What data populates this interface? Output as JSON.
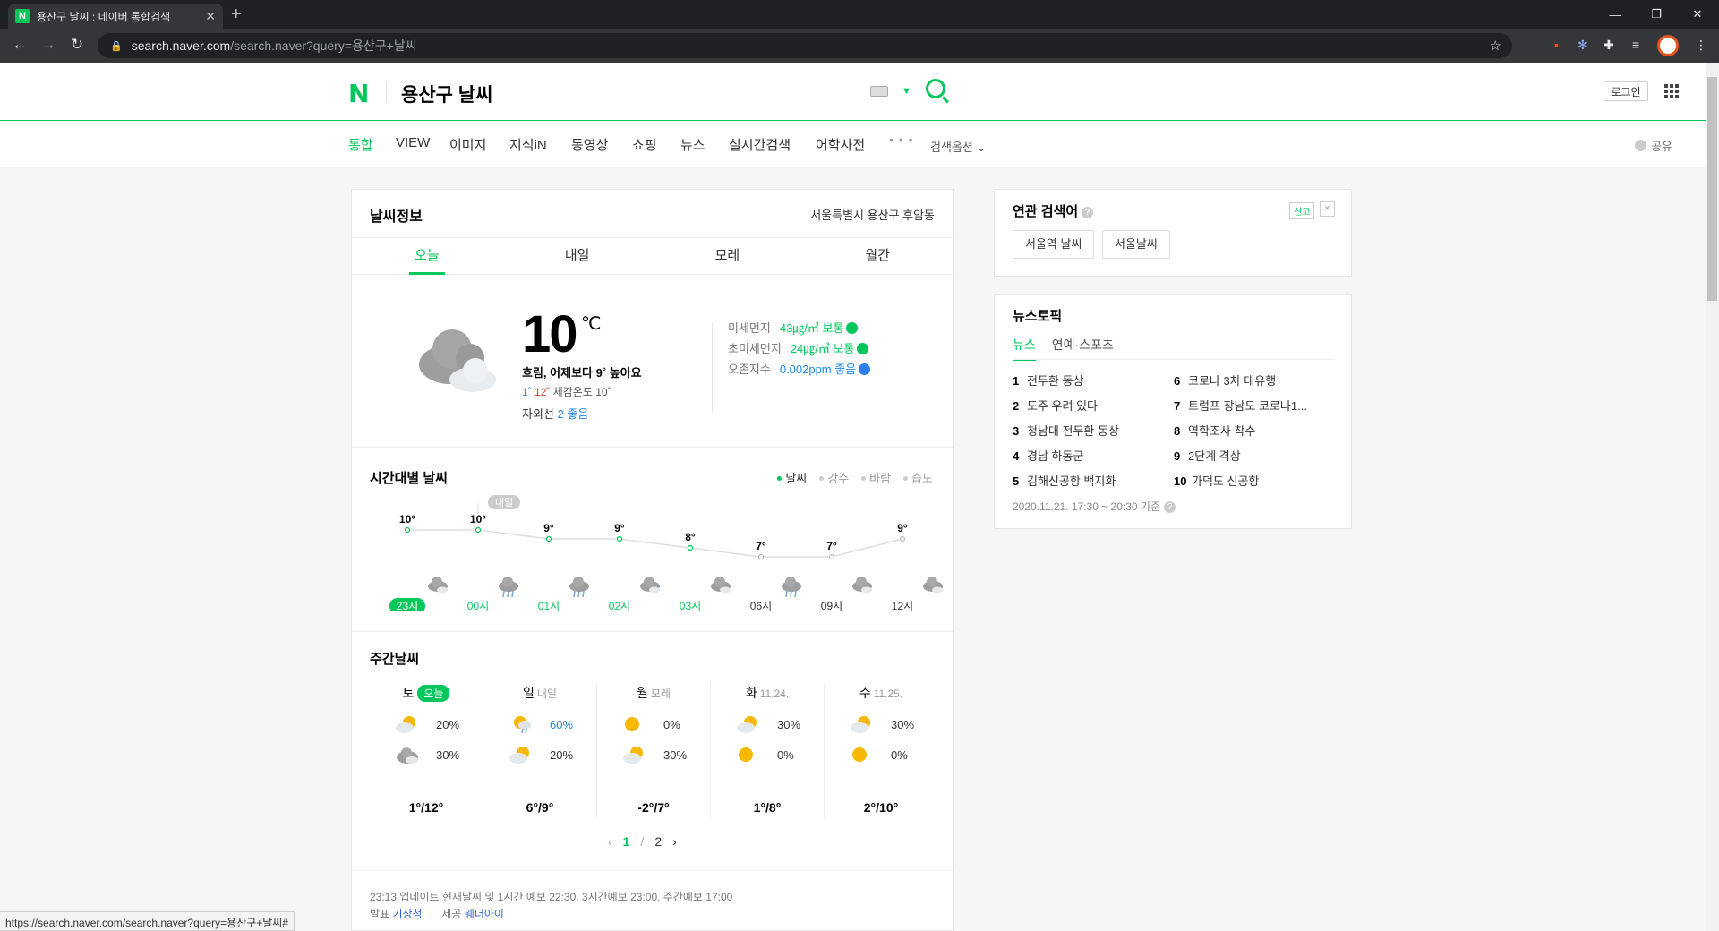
{
  "browser": {
    "tab_title": "용산구 날씨 : 네이버 통합검색",
    "tab_favicon": "N",
    "url_host": "search.naver.com",
    "url_path": "/search.naver?query=용산구+날씨",
    "status_url": "https://search.naver.com/search.naver?query=용산구+날씨#"
  },
  "header": {
    "logo": "N",
    "query": "용산구 날씨",
    "login_label": "로그인"
  },
  "menu": {
    "items": [
      "통합",
      "VIEW",
      "이미지",
      "지식iN",
      "동영상",
      "쇼핑",
      "뉴스",
      "실시간검색",
      "어학사전"
    ],
    "more": "• • •",
    "options": "검색옵션 ⌄",
    "share": "공유"
  },
  "weather": {
    "title": "날씨정보",
    "location": "서울특별시 용산구 후암동",
    "tabs": [
      "오늘",
      "내일",
      "모레",
      "월간"
    ],
    "current": {
      "temp": "10",
      "unit": "℃",
      "desc": "흐림, 어제보다 9˚ 높아요",
      "min": "1˚",
      "max": "12˚",
      "feels": "체감온도 10˚",
      "uv_label": "자외선",
      "uv_value": "2 좋음"
    },
    "air": [
      {
        "label": "미세먼지",
        "value": "43㎍/㎥ 보통"
      },
      {
        "label": "초미세먼지",
        "value": "24㎍/㎥ 보통"
      },
      {
        "label": "오존지수",
        "value": "0.002ppm 좋음"
      }
    ],
    "hourly_title": "시간대별 날씨",
    "hourly_options": [
      "날씨",
      "강수",
      "바람",
      "습도"
    ],
    "tomorrow_tag": "내일",
    "weekly_title": "주간날씨",
    "weekly": [
      {
        "day": "토",
        "sub": "오늘",
        "am": "20%",
        "pm": "30%",
        "range": "1°/12°"
      },
      {
        "day": "일",
        "sub": "내일",
        "am": "60%",
        "pm": "20%",
        "range": "6°/9°"
      },
      {
        "day": "월",
        "sub": "모레",
        "am": "0%",
        "pm": "30%",
        "range": "-2°/7°"
      },
      {
        "day": "화",
        "sub": "11.24.",
        "am": "30%",
        "pm": "0%",
        "range": "1°/8°"
      },
      {
        "day": "수",
        "sub": "11.25.",
        "am": "30%",
        "pm": "0%",
        "range": "2°/10°"
      }
    ],
    "pager": {
      "prev": "‹",
      "current": "1",
      "sep": "/",
      "next_page": "2",
      "next": "›"
    },
    "footer_update": "23:13 업데이트 현재날씨 및 1시간 예보 22:30, 3시간예보 23:00, 주간예보 17:00",
    "footer_source_label": "발표",
    "footer_source": "기상청",
    "footer_provider_label": "제공",
    "footer_provider": "웨더아이"
  },
  "chart_data": {
    "type": "line",
    "categories": [
      "23시",
      "00시",
      "01시",
      "02시",
      "03시",
      "06시",
      "09시",
      "12시"
    ],
    "values": [
      10,
      10,
      9,
      9,
      8,
      7,
      7,
      9
    ],
    "value_labels": [
      "10°",
      "10°",
      "9°",
      "9°",
      "8°",
      "7°",
      "7°",
      "9°"
    ],
    "icons": [
      "cloud-icon",
      "rain-cloud-icon",
      "rain-cloud-icon",
      "cloud-icon",
      "cloud-icon",
      "rain-cloud-icon",
      "cloud-icon",
      "cloud-icon"
    ],
    "colors": {
      "line": "#dddddd",
      "active": "#03c75a",
      "point": "#03c75a"
    }
  },
  "related": {
    "title": "연관 검색어",
    "report": "신고",
    "close": "×",
    "chips": [
      "서울역 날씨",
      "서울날씨"
    ]
  },
  "news": {
    "title": "뉴스토픽",
    "tabs": [
      "뉴스",
      "연예·스포츠"
    ],
    "items": [
      {
        "rank": "1",
        "text": "전두환 동상"
      },
      {
        "rank": "2",
        "text": "도주 우려 있다"
      },
      {
        "rank": "3",
        "text": "청남대 전두환 동상"
      },
      {
        "rank": "4",
        "text": "경남 하동군"
      },
      {
        "rank": "5",
        "text": "김해신공항 백지화"
      },
      {
        "rank": "6",
        "text": "코로나 3차 대유행"
      },
      {
        "rank": "7",
        "text": "트럼프 장남도 코로나1..."
      },
      {
        "rank": "8",
        "text": "역학조사 착수"
      },
      {
        "rank": "9",
        "text": "2단계 격상"
      },
      {
        "rank": "10",
        "text": "가덕도 신공항"
      }
    ],
    "timestamp": "2020.11.21. 17:30 ~ 20:30 기준"
  },
  "colors": {
    "brand": "#03c75a",
    "link": "#3266cc",
    "cold": "#1e88e5",
    "hot": "#e53935"
  }
}
